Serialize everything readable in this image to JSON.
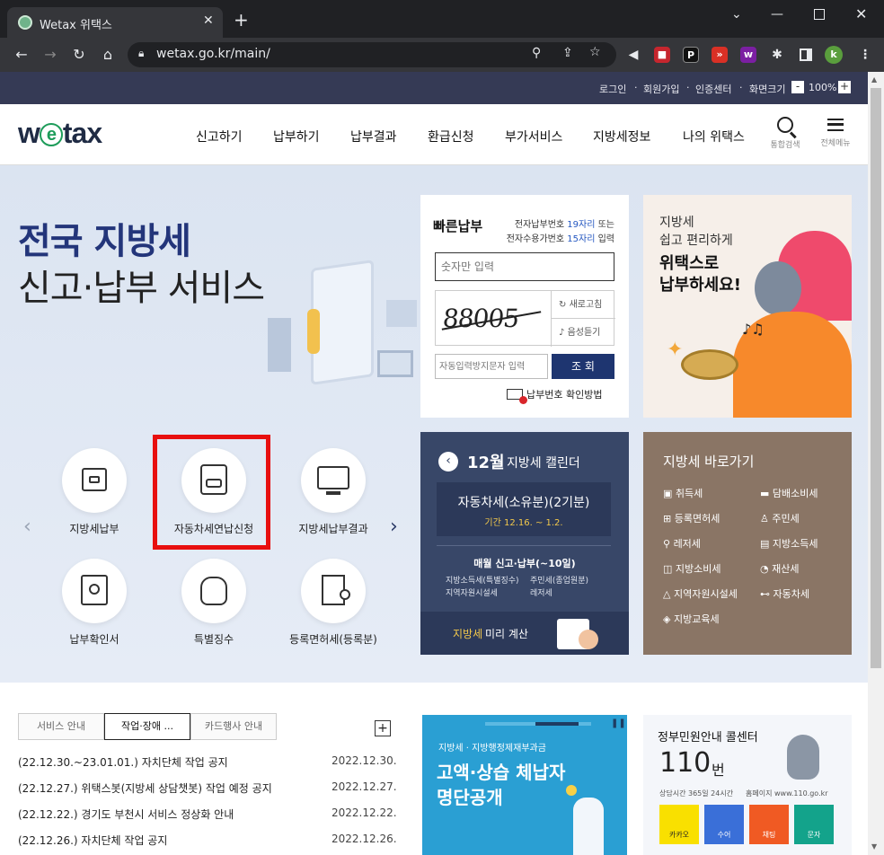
{
  "browser": {
    "tab_title": "Wetax 위택스",
    "url": "wetax.go.kr/main/",
    "profile_initial": "k"
  },
  "topbar": {
    "links": [
      "로그인",
      "회원가입",
      "인증센터",
      "화면크기"
    ],
    "zoom_minus": "-",
    "zoom": "100%",
    "zoom_plus": "+"
  },
  "header": {
    "logo": "wetax",
    "nav": [
      "신고하기",
      "납부하기",
      "납부결과",
      "환급신청",
      "부가서비스",
      "지방세정보",
      "나의 위택스"
    ],
    "search_label": "통합검색",
    "menu_label": "전체메뉴"
  },
  "hero": {
    "line1": "전국 지방세",
    "line2": "신고·납부 서비스",
    "services": [
      {
        "label": "지방세납부",
        "icon": "card-icon"
      },
      {
        "label": "자동차세연납신청",
        "icon": "car-calendar-icon"
      },
      {
        "label": "지방세납부결과",
        "icon": "monitor-icon"
      },
      {
        "label": "납부확인서",
        "icon": "receipt-icon"
      },
      {
        "label": "특별징수",
        "icon": "money-bag-icon"
      },
      {
        "label": "등록면허세(등록분)",
        "icon": "building-icon"
      }
    ]
  },
  "quickpay": {
    "title": "빠른납부",
    "info1_pre": "전자납부번호 ",
    "info1_em": "19자리",
    "info1_post": " 또는",
    "info2_pre": "전자수용가번호 ",
    "info2_em": "15자리",
    "info2_post": " 입력",
    "input_placeholder": "숫자만 입력",
    "captcha": "88005",
    "refresh": "새로고침",
    "audio": "음성듣기",
    "captcha_placeholder": "자동입력방지문자 입력",
    "submit": "조 회",
    "help": "납부번호 확인방법"
  },
  "promo": {
    "line1": "지방세",
    "line2": "쉽고 편리하게",
    "line3": "위택스로",
    "line4": "납부하세요!"
  },
  "calendar": {
    "month": "12월",
    "title": "지방세 캘린더",
    "event": "자동차세(소유분)(2기분)",
    "period": "기간 12.16. ~ 1.2.",
    "monthly": "매월 신고·납부(~10일)",
    "items": [
      "지방소득세(특별징수)",
      "주민세(종업원분)",
      "지역자원시설세",
      "레저세"
    ],
    "calc_em": "지방세",
    "calc": " 미리 계산"
  },
  "shortcut": {
    "title": "지방세 바로가기",
    "items": [
      "취득세",
      "담배소비세",
      "등록면허세",
      "주민세",
      "레저세",
      "지방소득세",
      "지방소비세",
      "재산세",
      "지역자원시설세",
      "자동차세",
      "지방교육세"
    ]
  },
  "notices": {
    "tabs": [
      "서비스 안내",
      "작업·장애 ...",
      "카드행사 안내"
    ],
    "more": "+",
    "rows": [
      {
        "title": "(22.12.30.~23.01.01.) 자치단체 작업 공지",
        "date": "2022.12.30."
      },
      {
        "title": "(22.12.27.) 위택스봇(지방세 상담챗봇) 작업 예정 공지",
        "date": "2022.12.27."
      },
      {
        "title": "(22.12.22.) 경기도 부천시 서비스 정상화 안내",
        "date": "2022.12.22."
      },
      {
        "title": "(22.12.26.) 자치단체 작업 공지",
        "date": "2022.12.26."
      }
    ]
  },
  "banner": {
    "sub": "지방세 · 지방행정제재부과금",
    "line1": "고액·상습 체납자",
    "line2": "명단공개"
  },
  "callcenter": {
    "title": "정부민원안내 콜센터",
    "number": "110",
    "unit": "번",
    "hours": "상담시간 365일 24시간",
    "homepage": "홈페이지 www.110.go.kr",
    "buttons": [
      "카카오",
      "수어",
      "채팅",
      "문자"
    ]
  }
}
